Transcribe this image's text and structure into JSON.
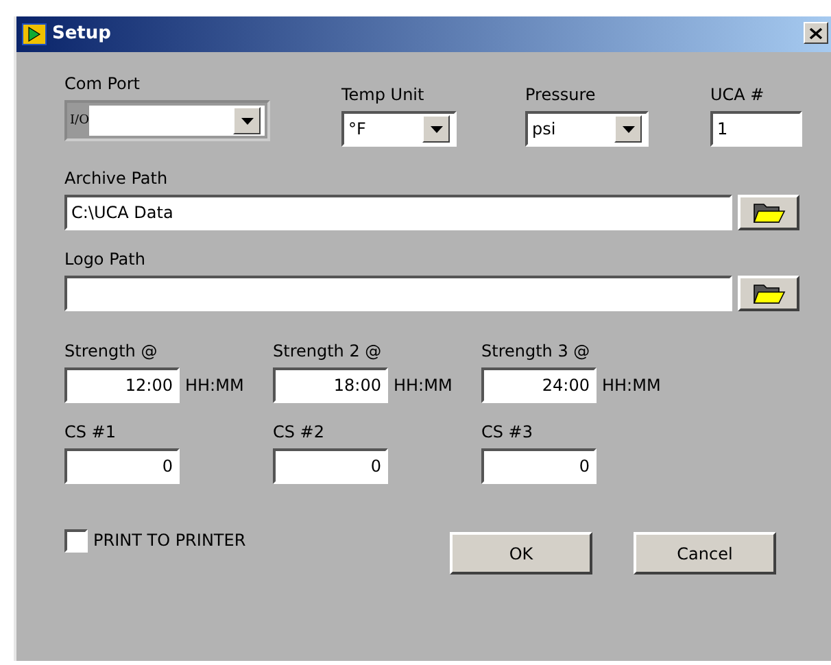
{
  "window": {
    "title": "Setup"
  },
  "com_port": {
    "label": "Com Port",
    "prefix": "I/O"
  },
  "selects": [
    {
      "label": "Temp Unit",
      "value": "°F"
    },
    {
      "label": "Pressure",
      "value": "psi"
    }
  ],
  "uca": {
    "label": "UCA #",
    "value": "1"
  },
  "paths": [
    {
      "label": "Archive Path",
      "value": "C:\\UCA Data"
    },
    {
      "label": "Logo Path"
    }
  ],
  "strengths": [
    {
      "label": "Strength @",
      "value": "12:00",
      "unit": "HH:MM"
    },
    {
      "label": "Strength 2 @",
      "value": "18:00",
      "unit": "HH:MM"
    },
    {
      "label": "Strength 3 @",
      "value": "24:00",
      "unit": "HH:MM"
    }
  ],
  "cs": [
    {
      "label": "CS #1",
      "value": "0"
    },
    {
      "label": "CS #2",
      "value": "0"
    },
    {
      "label": "CS #3",
      "value": "0"
    }
  ],
  "print_to_printer": {
    "label": "PRINT TO PRINTER",
    "checked": false
  },
  "buttons": [
    "OK",
    "Cancel"
  ]
}
